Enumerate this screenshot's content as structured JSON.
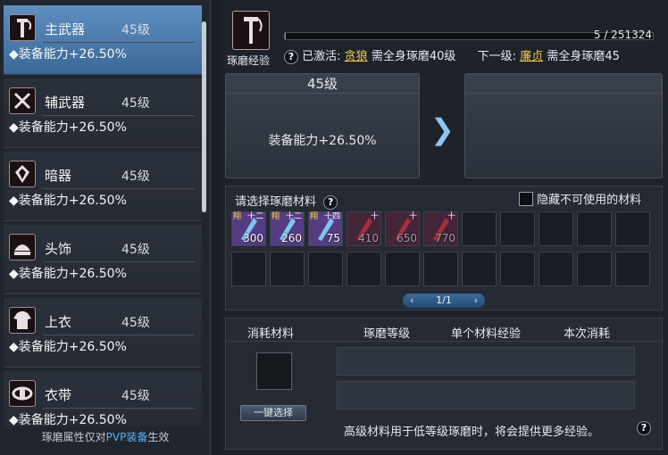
{
  "equipment_list": [
    {
      "name": "主武器",
      "level": "45级",
      "ability": "◆装备能力+26.50%",
      "icon": "main-weapon-icon",
      "selected": true
    },
    {
      "name": "辅武器",
      "level": "45级",
      "ability": "◆装备能力+26.50%",
      "icon": "sub-weapon-icon",
      "selected": false
    },
    {
      "name": "暗器",
      "level": "45级",
      "ability": "◆装备能力+26.50%",
      "icon": "hidden-weapon-icon",
      "selected": false
    },
    {
      "name": "头饰",
      "level": "45级",
      "ability": "◆装备能力+26.50%",
      "icon": "headgear-icon",
      "selected": false
    },
    {
      "name": "上衣",
      "level": "45级",
      "ability": "◆装备能力+26.50%",
      "icon": "top-armor-icon",
      "selected": false
    },
    {
      "name": "衣带",
      "level": "45级",
      "ability": "◆装备能力+26.50%",
      "icon": "belt-icon",
      "selected": false
    }
  ],
  "footer": {
    "prefix": "琢磨属性仅对",
    "highlight": "PVP装备",
    "suffix": "生效"
  },
  "header": {
    "icon_label": "琢磨经验",
    "exp_text": "5 / 251324",
    "exp_progress": 2e-05,
    "activated_label": "已激活:",
    "activated_name": "贪狼",
    "activated_req": "需全身琢磨40级",
    "next_label": "下一级:",
    "next_name": "廉贞",
    "next_req": "需全身琢磨45"
  },
  "current_level": {
    "title": "45级",
    "ability": "装备能力+26.50%"
  },
  "arrow": "❯",
  "materials": {
    "title": "请选择琢磨材料",
    "hide_label": "隐藏不可使用的材料",
    "items": [
      {
        "count": "300",
        "usable": true,
        "tag": "翔",
        "grade": "十二"
      },
      {
        "count": "260",
        "usable": true,
        "tag": "翔",
        "grade": "十二"
      },
      {
        "count": "75",
        "usable": true,
        "tag": "翔",
        "grade": "十四"
      },
      {
        "count": "410",
        "usable": false,
        "tag": "",
        "grade": "十"
      },
      {
        "count": "650",
        "usable": false,
        "tag": "",
        "grade": "十"
      },
      {
        "count": "770",
        "usable": false,
        "tag": "",
        "grade": "十"
      }
    ],
    "page": "1/1",
    "prev": "‹",
    "next": "›"
  },
  "consume": {
    "col1": "消耗材料",
    "col2": "琢磨等级",
    "col3": "单个材料经验",
    "col4": "本次消耗",
    "button": "一键选择",
    "hint": "高级材料用于低等级琢磨时，将会提供更多经验。"
  },
  "colors": {
    "accent_gold": "#f2c94c",
    "pvp_blue": "#57b6ff",
    "selected": "#4d7fb3"
  }
}
